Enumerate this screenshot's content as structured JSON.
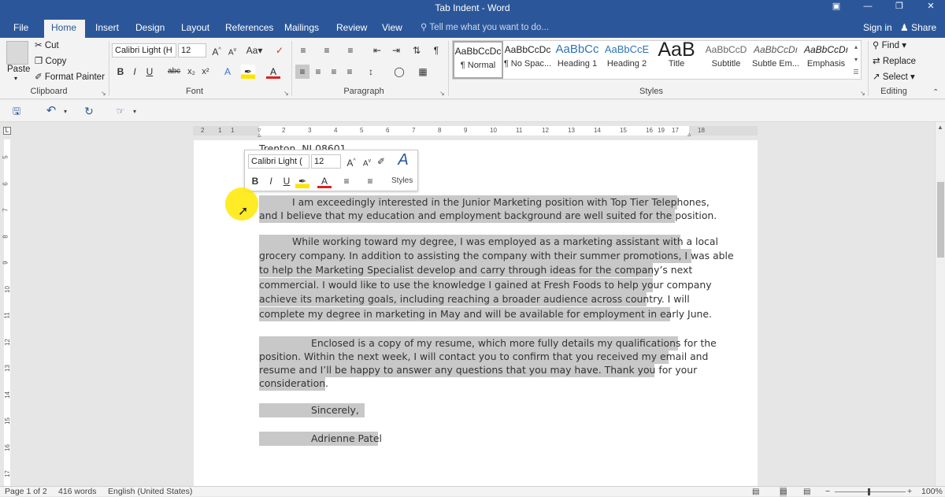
{
  "window": {
    "title": "Tab Indent - Word"
  },
  "tabs": [
    "File",
    "Home",
    "Insert",
    "Design",
    "Layout",
    "References",
    "Mailings",
    "Review",
    "View"
  ],
  "tell_me": "Tell me what you want to do...",
  "account": {
    "signin": "Sign in",
    "share": "Share"
  },
  "clipboard": {
    "paste": "Paste",
    "cut": "Cut",
    "copy": "Copy",
    "format_painter": "Format Painter",
    "label": "Clipboard"
  },
  "font": {
    "name": "Calibri Light (H",
    "size": "12",
    "label": "Font",
    "case": "Aa",
    "bold": "B",
    "italic": "I",
    "underline": "U",
    "strike": "abc",
    "sub": "x₂",
    "sup": "x²",
    "color_a": "A"
  },
  "paragraph": {
    "label": "Paragraph",
    "pilcrow": "¶"
  },
  "styles": {
    "label": "Styles",
    "items": [
      {
        "sample": "AaBbCcDc",
        "name": "¶ Normal"
      },
      {
        "sample": "AaBbCcDc",
        "name": "¶ No Spac..."
      },
      {
        "sample": "AaBbCc",
        "name": "Heading 1"
      },
      {
        "sample": "AaBbCcE",
        "name": "Heading 2"
      },
      {
        "sample": "AaB",
        "name": "Title"
      },
      {
        "sample": "AaBbCcD",
        "name": "Subtitle"
      },
      {
        "sample": "AaBbCcDı",
        "name": "Subtle Em..."
      },
      {
        "sample": "AaBbCcDı",
        "name": "Emphasis"
      }
    ]
  },
  "editing": {
    "find": "Find",
    "replace": "Replace",
    "select": "Select",
    "label": "Editing"
  },
  "ruler": {
    "marks": [
      "2",
      "1",
      "1",
      "2",
      "3",
      "4",
      "5",
      "6",
      "7",
      "8",
      "9",
      "10",
      "11",
      "12",
      "13",
      "14",
      "15",
      "16",
      "17",
      "18",
      "19"
    ]
  },
  "vruler_marks": [
    "5",
    "6",
    "7",
    "8",
    "9",
    "10",
    "11",
    "12",
    "13",
    "14",
    "15",
    "16",
    "17"
  ],
  "mini_toolbar": {
    "font": "Calibri Light (",
    "size": "12",
    "styles": "Styles"
  },
  "document": {
    "address_fragment": "Trenton, NJ 08601",
    "lines": [
      {
        "text": "I am exceedingly interested in the Junior Marketing position with Top Tier Telephones,",
        "indent": 42,
        "selected": true
      },
      {
        "text": "and I believe that my education and employment background are well suited for the position.",
        "indent": 0,
        "selected": true
      },
      {
        "text": "While working toward my degree, I was employed as a marketing assistant with a local",
        "indent": 42,
        "selected": true
      },
      {
        "text": "grocery company. In addition to assisting the company with their summer promotions, I was able",
        "indent": 0,
        "selected": true
      },
      {
        "text": "to help the Marketing Specialist develop and carry through ideas for the company’s next",
        "indent": 0,
        "selected": true
      },
      {
        "text": "commercial. I would like to use the knowledge I gained at Fresh Foods to help your company",
        "indent": 0,
        "selected": true
      },
      {
        "text": "achieve its marketing goals, including reaching a broader audience across country. I will",
        "indent": 0,
        "selected": true
      },
      {
        "text": "complete my degree in marketing in May and will be available for employment in early June.",
        "indent": 0,
        "selected": true
      },
      {
        "text": "Enclosed is a copy of my resume, which more fully details my qualifications for the",
        "indent": 66,
        "selected": true
      },
      {
        "text": "position. Within the next week, I will contact you to confirm that you received my email and",
        "indent": 0,
        "selected": true
      },
      {
        "text": "resume and I’ll be happy to answer any questions that you may have. Thank you for your",
        "indent": 0,
        "selected": true
      },
      {
        "text": "consideration.",
        "indent": 0,
        "selected": true
      },
      {
        "text": "Sincerely,",
        "indent": 66,
        "selected": true
      },
      {
        "text": "Adrienne Patel",
        "indent": 66,
        "selected": true
      }
    ]
  },
  "status": {
    "page": "Page 1 of 2",
    "words": "416 words",
    "language": "English (United States)",
    "zoom": "100%"
  }
}
